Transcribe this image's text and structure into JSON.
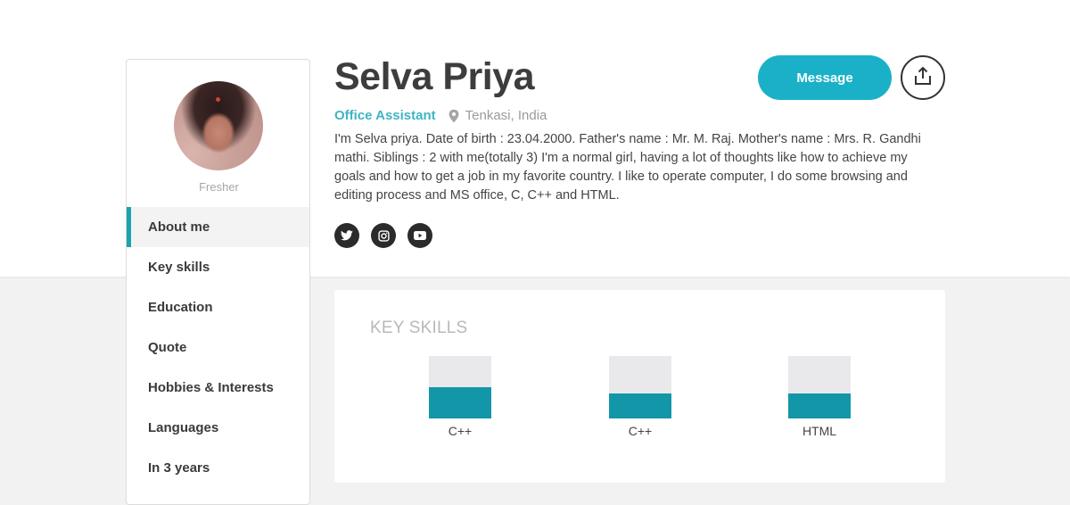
{
  "profile": {
    "name": "Selva Priya",
    "role": "Office Assistant",
    "location": "Tenkasi, India",
    "status": "Fresher",
    "bio": "I'm Selva priya. Date of birth : 23.04.2000. Father's name : Mr. M. Raj. Mother's name : Mrs. R. Gandhi mathi. Siblings : 2 with me(totally 3) I'm a normal girl, having a lot of thoughts like how to achieve my goals and how to get a job in my favorite country. I like to operate computer, I do some browsing and editing process and MS office, C, C++ and HTML."
  },
  "actions": {
    "message_label": "Message",
    "share_icon": "share-icon"
  },
  "socials": [
    "twitter-icon",
    "instagram-icon",
    "youtube-icon"
  ],
  "sidebar": {
    "items": [
      {
        "label": "About me",
        "active": true
      },
      {
        "label": "Key skills"
      },
      {
        "label": "Education"
      },
      {
        "label": "Quote"
      },
      {
        "label": "Hobbies & Interests"
      },
      {
        "label": "Languages"
      },
      {
        "label": "In 3 years"
      }
    ]
  },
  "skills": {
    "title": "KEY SKILLS",
    "items": [
      {
        "label": "C++",
        "level": 0.5
      },
      {
        "label": "C++",
        "level": 0.4
      },
      {
        "label": "HTML",
        "level": 0.4
      }
    ]
  },
  "colors": {
    "accent": "#1ab1c8",
    "skill_bar": "#1296a8",
    "role_text": "#3fb5c4",
    "active_marker": "#1aa3b1"
  }
}
